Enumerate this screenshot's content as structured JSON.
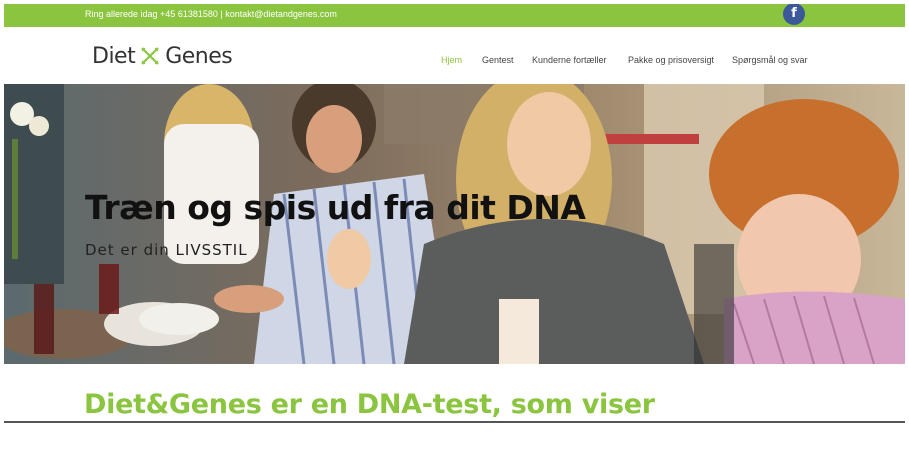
{
  "topbar": {
    "contact_text": "Ring allerede idag +45 61381580  |  kontakt@dietandgenes.com",
    "facebook_glyph": "f"
  },
  "logo": {
    "left_word": "Diet",
    "right_word": "Genes"
  },
  "nav": {
    "items": [
      {
        "label": "Hjem",
        "active": true
      },
      {
        "label": "Gentest",
        "active": false
      },
      {
        "label": "Kunderne fortæller",
        "active": false
      },
      {
        "label": "Pakke og prisoversigt",
        "active": false
      },
      {
        "label": "Spørgsmål og svar",
        "active": false
      }
    ]
  },
  "hero": {
    "title": "Træn og spis ud fra dit DNA",
    "subtitle": "Det er din LIVSSTIL"
  },
  "headline": "Diet&Genes er en DNA-test, som viser",
  "colors": {
    "accent": "#8bc53f",
    "facebook": "#3b5998"
  }
}
